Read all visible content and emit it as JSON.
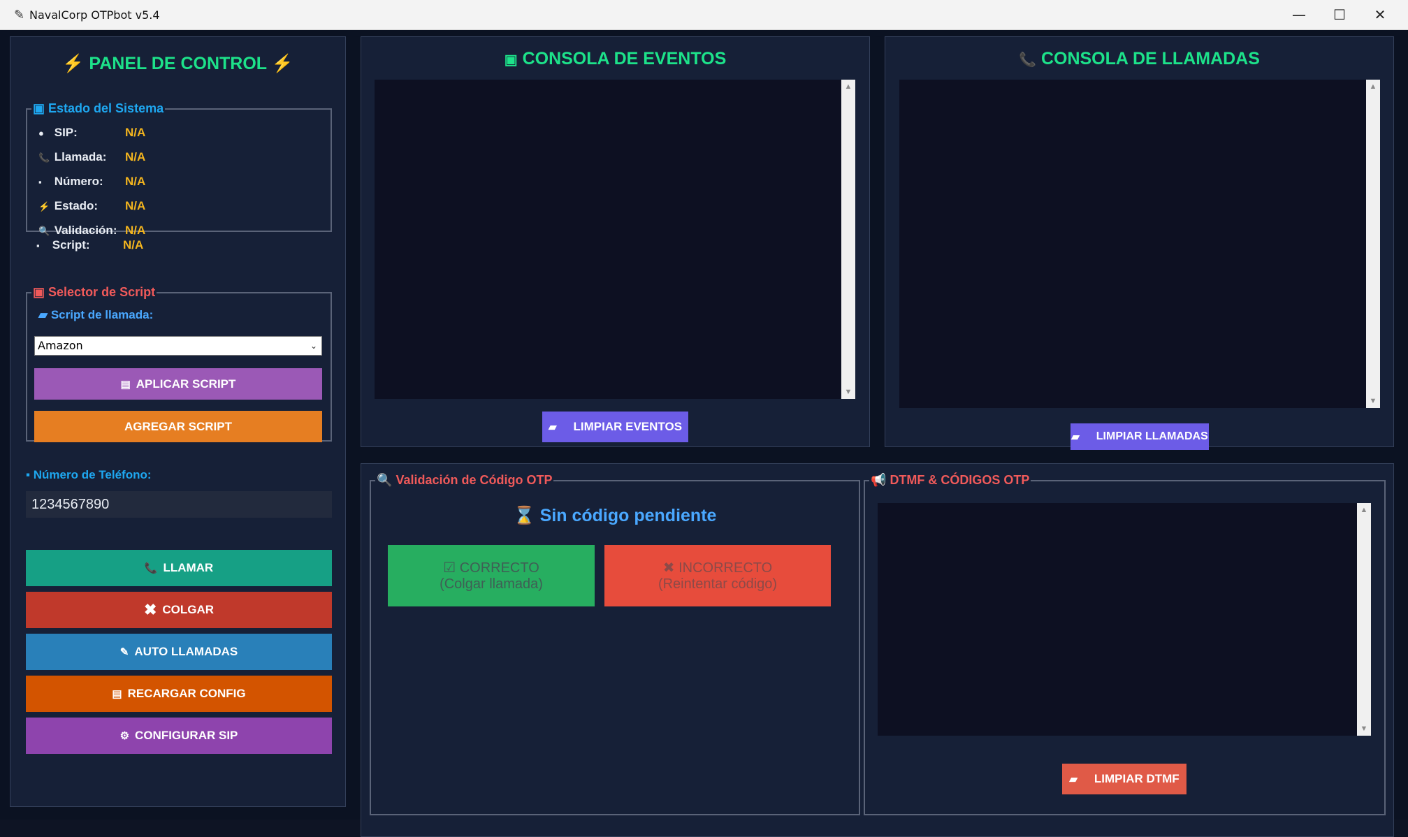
{
  "window": {
    "title": "NavalCorp OTPbot v5.4",
    "minimize": "—",
    "maximize": "☐",
    "close": "✕"
  },
  "control": {
    "title": "PANEL DE CONTROL",
    "bolt_icon": "lightning-icon",
    "system_status": {
      "legend": "Estado del Sistema",
      "rows": [
        {
          "icon": "●",
          "label": "SIP:",
          "value": "N/A"
        },
        {
          "icon": "📞",
          "label": "Llamada:",
          "value": "N/A"
        },
        {
          "icon": "▪",
          "label": "Número:",
          "value": "N/A"
        },
        {
          "icon": "⚡",
          "label": "Estado:",
          "value": "N/A"
        },
        {
          "icon": "🔍",
          "label": "Validación:",
          "value": "N/A"
        },
        {
          "icon": "▪",
          "label": "Script:",
          "value": "N/A"
        }
      ]
    },
    "script_selector": {
      "legend": "Selector de Script",
      "label": "Script de llamada:",
      "selected": "Amazon",
      "apply_label": "APLICAR SCRIPT",
      "add_label": "AGREGAR SCRIPT"
    },
    "phone": {
      "label": "Número de Teléfono:",
      "value": "1234567890"
    },
    "actions": {
      "call": "LLAMAR",
      "hangup": "COLGAR",
      "auto": "AUTO LLAMADAS",
      "reload": "RECARGAR CONFIG",
      "sip": "CONFIGURAR SIP"
    }
  },
  "events": {
    "title": "CONSOLA DE EVENTOS",
    "clear_label": "LIMPIAR EVENTOS"
  },
  "calls": {
    "title": "CONSOLA DE LLAMADAS",
    "clear_label": "LIMPIAR LLAMADAS"
  },
  "otp": {
    "legend": "Validación de Código OTP",
    "status": "Sin código pendiente",
    "correct_title": "CORRECTO",
    "correct_sub": "(Colgar llamada)",
    "incorrect_title": "INCORRECTO",
    "incorrect_sub": "(Reintentar código)"
  },
  "dtmf": {
    "legend": "DTMF & CÓDIGOS OTP",
    "clear_label": "LIMPIAR DTMF"
  },
  "colors": {
    "accent_green": "#1de28a",
    "value_yellow": "#f4b51e",
    "legend_blue": "#1ea7f0",
    "legend_red": "#f05a5a",
    "purple": "#9b59b6",
    "orange": "#e67e22",
    "teal": "#16a085",
    "red": "#c0392b",
    "blue": "#2980b9",
    "dark_orange": "#d35400",
    "violet": "#8e44ad",
    "indigo": "#6c5ce7"
  }
}
